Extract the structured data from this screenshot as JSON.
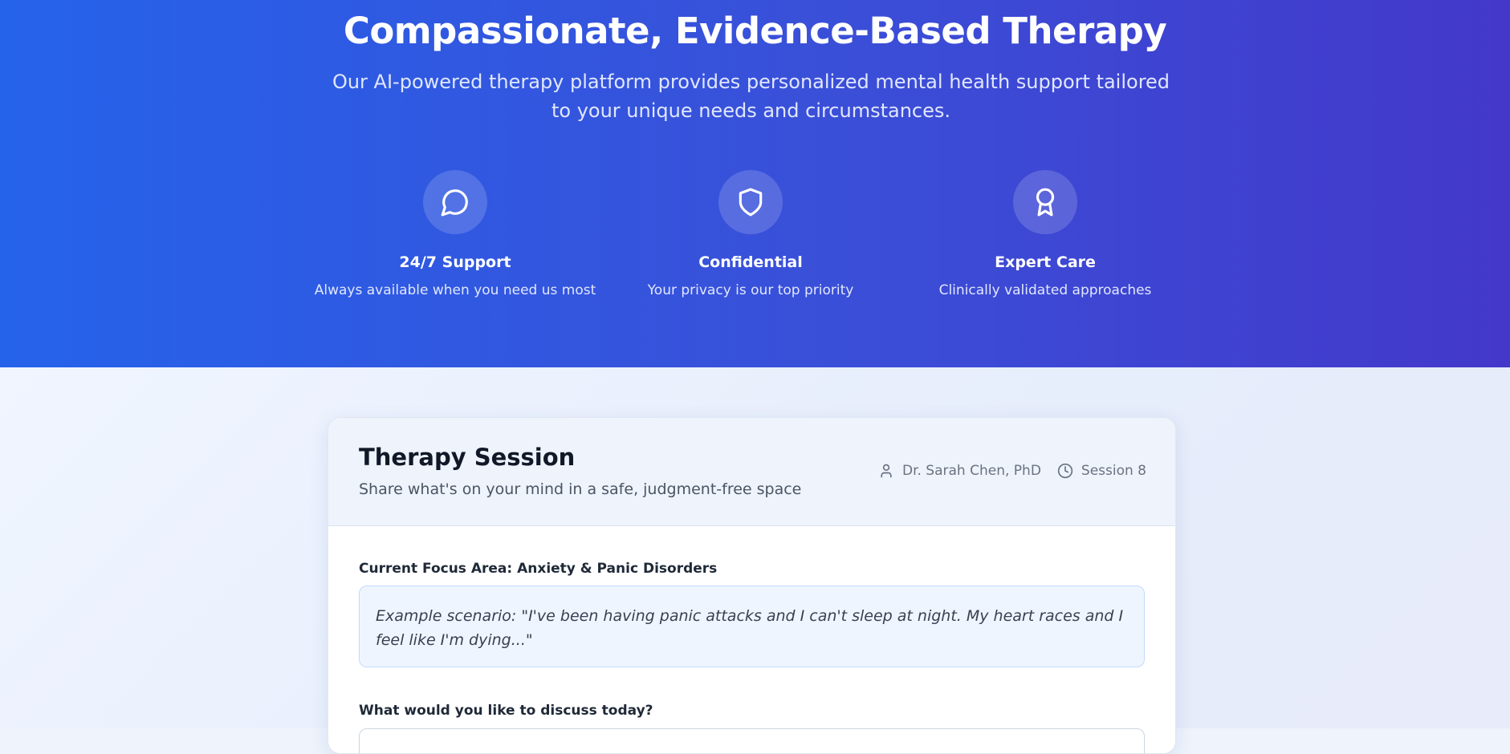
{
  "hero": {
    "title": "Compassionate, Evidence-Based Therapy",
    "subtitle": "Our AI-powered therapy platform provides personalized mental health support tailored to your unique needs and circumstances.",
    "features": [
      {
        "icon": "chat-bubble-icon",
        "title": "24/7 Support",
        "description": "Always available when you need us most"
      },
      {
        "icon": "shield-icon",
        "title": "Confidential",
        "description": "Your privacy is our top priority"
      },
      {
        "icon": "award-icon",
        "title": "Expert Care",
        "description": "Clinically validated approaches"
      }
    ]
  },
  "session": {
    "title": "Therapy Session",
    "subtitle": "Share what's on your mind in a safe, judgment-free space",
    "therapist": "Dr. Sarah Chen, PhD",
    "session_label": "Session 8",
    "focus_label": "Current Focus Area: Anxiety & Panic Disorders",
    "scenario": "Example scenario: \"I've been having panic attacks and I can't sleep at night. My heart races and I feel like I'm dying...\"",
    "discuss_label": "What would you like to discuss today?",
    "message_value": ""
  },
  "colors": {
    "hero_start": "#2563eb",
    "hero_end": "#4338ca",
    "scenario_bg": "#eff5ff",
    "scenario_border": "#bfdbfe"
  }
}
